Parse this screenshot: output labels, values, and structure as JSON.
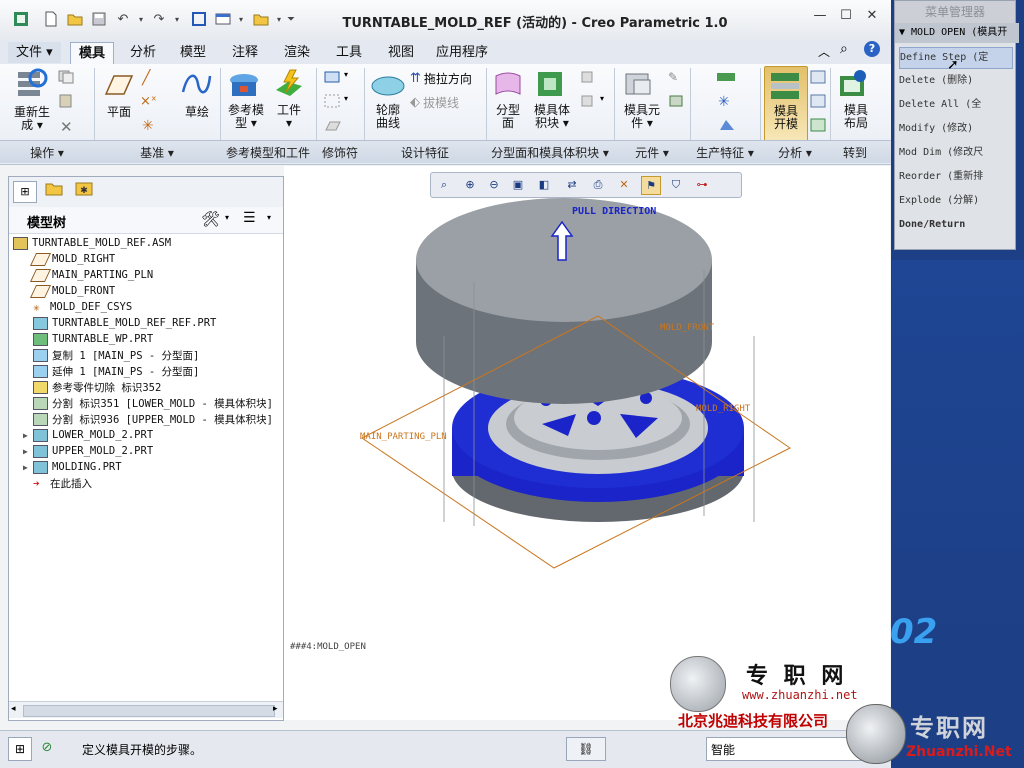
{
  "window": {
    "title": "TURNTABLE_MOLD_REF (活动的) - Creo Parametric 1.0",
    "min": "—",
    "max": "☐",
    "close": "✕"
  },
  "tabs": [
    {
      "label": "文件 ▾"
    },
    {
      "label": "模具",
      "active": true
    },
    {
      "label": "分析"
    },
    {
      "label": "模型"
    },
    {
      "label": "注释"
    },
    {
      "label": "渲染"
    },
    {
      "label": "工具"
    },
    {
      "label": "视图"
    },
    {
      "label": "应用程序"
    }
  ],
  "ribbon": {
    "buttons": {
      "regen": "重新生\n成 ▾",
      "plane": "平面",
      "sketch": "草绘",
      "ref_model": "参考模\n型 ▾",
      "workpiece": "工件\n▾",
      "pull_direction": "拖拉方向",
      "draft_line": "拔模线",
      "contour_curve": "轮廓\n曲线",
      "parting_surface": "分型\n面",
      "mold_volume": "模具体\n积块 ▾",
      "mold_component": "模具元\n件 ▾",
      "mold_open": "模具\n开模",
      "mold_layout": "模具\n布局"
    },
    "groups": {
      "operations": "操作 ▾",
      "datum": "基准 ▾",
      "ref_model_workpiece": "参考模型和工件",
      "modifiers": "修饰符",
      "design_features": "设计特征",
      "parting": "分型面和模具体积块 ▾",
      "components": "元件 ▾",
      "production": "生产特征 ▾",
      "analysis": "分析 ▾",
      "goto": "转到"
    }
  },
  "model_tree": {
    "title": "模型树",
    "items": [
      {
        "label": "TURNTABLE_MOLD_REF.ASM",
        "icon": "assembly-icon",
        "indent": 0,
        "expand": ""
      },
      {
        "label": "MOLD_RIGHT",
        "icon": "datum-plane-icon",
        "indent": 1,
        "expand": ""
      },
      {
        "label": "MAIN_PARTING_PLN",
        "icon": "datum-plane-icon",
        "indent": 1,
        "expand": ""
      },
      {
        "label": "MOLD_FRONT",
        "icon": "datum-plane-icon",
        "indent": 1,
        "expand": ""
      },
      {
        "label": "MOLD_DEF_CSYS",
        "icon": "csys-icon",
        "indent": 1,
        "expand": ""
      },
      {
        "label": "TURNTABLE_MOLD_REF_REF.PRT",
        "icon": "ref-part-icon",
        "indent": 1,
        "expand": ""
      },
      {
        "label": "TURNTABLE_WP.PRT",
        "icon": "workpiece-icon",
        "indent": 1,
        "expand": ""
      },
      {
        "label": "复制 1 [MAIN_PS - 分型面]",
        "icon": "surface-copy-icon",
        "indent": 1,
        "expand": ""
      },
      {
        "label": "延伸 1 [MAIN_PS - 分型面]",
        "icon": "surface-extend-icon",
        "indent": 1,
        "expand": ""
      },
      {
        "label": "参考零件切除 标识352",
        "icon": "ref-cut-icon",
        "indent": 1,
        "expand": ""
      },
      {
        "label": "分割 标识351 [LOWER_MOLD - 模具体积块]",
        "icon": "split-icon",
        "indent": 1,
        "expand": ""
      },
      {
        "label": "分割 标识936 [UPPER_MOLD - 模具体积块]",
        "icon": "split-icon",
        "indent": 1,
        "expand": ""
      },
      {
        "label": "LOWER_MOLD_2.PRT",
        "icon": "mold-part-icon",
        "indent": 1,
        "expand": "▶"
      },
      {
        "label": "UPPER_MOLD_2.PRT",
        "icon": "mold-part-icon",
        "indent": 1,
        "expand": "▶"
      },
      {
        "label": "MOLDING.PRT",
        "icon": "molding-icon",
        "indent": 1,
        "expand": "▶"
      },
      {
        "label": "在此插入",
        "icon": "insert-here-icon",
        "indent": 1,
        "expand": ""
      }
    ]
  },
  "graphics": {
    "pull_direction_label": "PULL DIRECTION",
    "mold_front_label": "MOLD_FRONT",
    "mold_right_label": "MOLD_RIGHT",
    "main_parting_label": "MAIN_PARTING_PLN",
    "step_label": "###4:MOLD_OPEN"
  },
  "menu_manager": {
    "title": "菜单管理器",
    "header": "▼ MOLD OPEN (模具开",
    "items": [
      {
        "label": "Define Step (定",
        "selected": true
      },
      {
        "label": "Delete (删除)"
      },
      {
        "label": "Delete All (全"
      },
      {
        "label": "Modify (修改)"
      },
      {
        "label": "Mod Dim (修改尺"
      },
      {
        "label": "Reorder (重新排"
      },
      {
        "label": "Explode (分解)"
      },
      {
        "label": "Done/Return"
      }
    ]
  },
  "status": {
    "message": "定义模具开模的步骤。",
    "filter": "智能"
  },
  "watermark": {
    "cn_name": "专 职 网",
    "url": "www.zhuanzhi.net",
    "company": "北京兆迪科技有限公司",
    "corner_cn": "专职网",
    "corner_url": "Zhuanzhi.Net",
    "big": "02"
  },
  "colors": {
    "accent": "#1e4da0",
    "mold_blue": "#1a24c8",
    "mold_gray": "#6f757b",
    "datum_orange": "#c9761f",
    "status_red": "#c00000"
  }
}
